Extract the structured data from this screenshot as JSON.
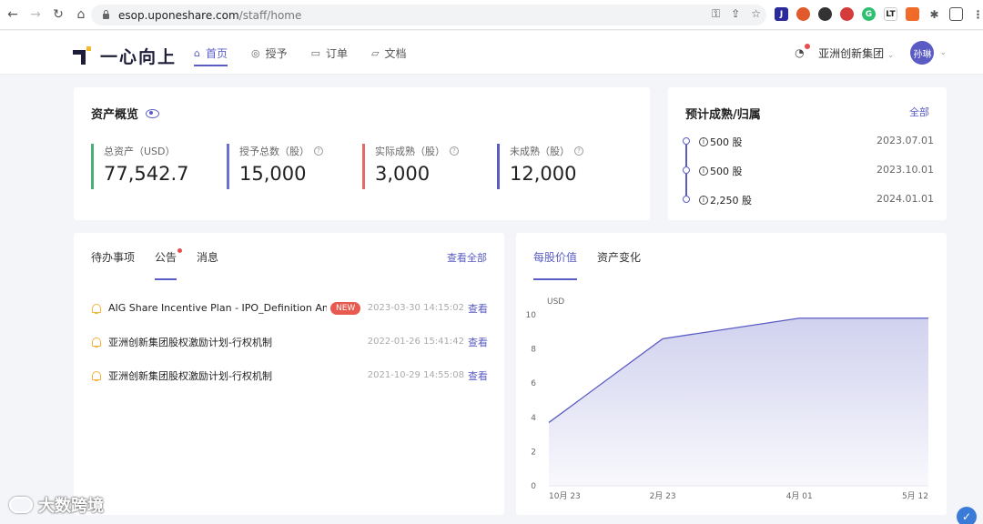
{
  "browser": {
    "url_host": "esop.uponeshare.com",
    "url_path": "/staff/home"
  },
  "header": {
    "logo_text": "一心向上",
    "nav": [
      {
        "label": "首页",
        "active": true
      },
      {
        "label": "授予",
        "active": false
      },
      {
        "label": "订单",
        "active": false
      },
      {
        "label": "文档",
        "active": false
      }
    ],
    "company": "亚洲创新集团",
    "avatar": "孙琳"
  },
  "assets": {
    "title": "资产概览",
    "stats": [
      {
        "label": "总资产（USD）",
        "value": "77,542.7",
        "color": "#4caf7a",
        "help": false
      },
      {
        "label": "授予总数（股）",
        "value": "15,000",
        "color": "#6c6fd0",
        "help": true
      },
      {
        "label": "实际成熟（股）",
        "value": "3,000",
        "color": "#e46a6a",
        "help": true
      },
      {
        "label": "未成熟（股）",
        "value": "12,000",
        "color": "#5a5cc4",
        "help": true
      }
    ]
  },
  "vesting": {
    "title": "预计成熟/归属",
    "all_link": "全部",
    "items": [
      {
        "shares": "500 股",
        "date": "2023.07.01"
      },
      {
        "shares": "500 股",
        "date": "2023.10.01"
      },
      {
        "shares": "2,250 股",
        "date": "2024.01.01"
      }
    ]
  },
  "notices": {
    "tabs": [
      "待办事项",
      "公告",
      "消息"
    ],
    "active_tab": "公告",
    "view_all": "查看全部",
    "items": [
      {
        "title": "AIG Share Incentive Plan - IPO_Definition Am...",
        "badge": "NEW",
        "time": "2023-03-30 14:15:02",
        "action": "查看"
      },
      {
        "title": "亚洲创新集团股权激励计划-行权机制",
        "badge": "",
        "time": "2022-01-26 15:41:42",
        "action": "查看"
      },
      {
        "title": "亚洲创新集团股权激励计划-行权机制",
        "badge": "",
        "time": "2021-10-29 14:55:08",
        "action": "查看"
      }
    ]
  },
  "chart_tabs": [
    "每股价值",
    "资产变化"
  ],
  "chart_data": {
    "type": "area",
    "x": [
      "10月 23",
      "2月 23",
      "4月 01",
      "5月 12"
    ],
    "y": [
      3.7,
      8.6,
      9.8,
      9.8
    ],
    "ylabel": "USD",
    "ylim": [
      0,
      10
    ],
    "yticks": [
      0,
      2,
      4,
      6,
      8,
      10
    ],
    "grid": false,
    "color": "#5a5cc4"
  },
  "watermark": "大数跨境"
}
